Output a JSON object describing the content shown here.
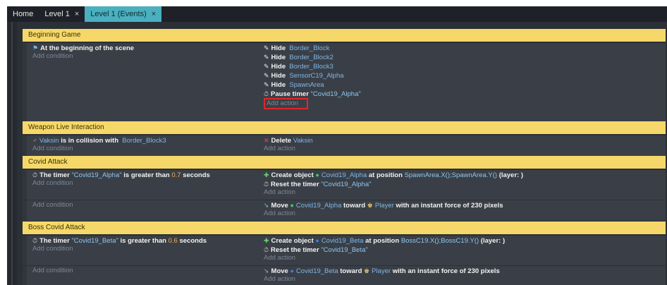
{
  "tabs": [
    {
      "label": "Home",
      "close": ""
    },
    {
      "label": "Level 1",
      "close": "×"
    },
    {
      "label": "Level 1 (Events)",
      "close": "×"
    }
  ],
  "groups": [
    {
      "comment": "Beginning Game",
      "events": [
        {
          "conditions": [
            {
              "text": "At the beginning of the scene"
            }
          ],
          "add_condition": "Add condition",
          "actions": [
            {
              "verb": "Hide",
              "object": "Border_Block"
            },
            {
              "verb": "Hide",
              "object": "Border_Block2"
            },
            {
              "verb": "Hide",
              "object": "Border_Block3"
            },
            {
              "verb": "Hide",
              "object": "SensorC19_Alpha"
            },
            {
              "verb": "Hide",
              "object": "SpawnArea"
            },
            {
              "verb": "Pause timer",
              "value": "\"Covid19_Alpha\""
            }
          ],
          "add_action": "Add action"
        }
      ]
    },
    {
      "comment": "Weapon Live Interaction",
      "events": [
        {
          "conditions": [
            {
              "pre": "Vaksin",
              "mid": "is in collision with",
              "post": "Border_Block3"
            }
          ],
          "add_condition": "Add condition",
          "actions": [
            {
              "verb": "Delete",
              "object": "Vaksin"
            }
          ],
          "add_action": "Add action"
        }
      ]
    },
    {
      "comment": "Covid Attack",
      "events": [
        {
          "conditions": [
            {
              "pre": "The timer",
              "mid": "\"Covid19_Alpha\"",
              "post": "is greater than",
              "num": "0.7",
              "tail": "seconds"
            }
          ],
          "add_condition": "Add condition",
          "actions": [
            {
              "verb": "Create object",
              "object": "Covid19_Alpha",
              "extra": "at position",
              "value": "SpawnArea.X();SpawnArea.Y()",
              "tail": "(layer: )"
            },
            {
              "verb": "Reset the timer",
              "value": "\"Covid19_Alpha\""
            }
          ],
          "add_action": "Add action"
        },
        {
          "conditions": [],
          "add_condition": "Add condition",
          "actions": [
            {
              "verb": "Move",
              "object": "Covid19_Alpha",
              "extra": "toward",
              "value": "Player",
              "tail": "with an instant force of 230 pixels"
            }
          ],
          "add_action": "Add action"
        }
      ]
    },
    {
      "comment": "Boss Covid Attack",
      "events": [
        {
          "conditions": [
            {
              "pre": "The timer",
              "mid": "\"Covid19_Beta\"",
              "post": "is greater than",
              "num": "0.6",
              "tail": "seconds"
            }
          ],
          "add_condition": "Add condition",
          "actions": [
            {
              "verb": "Create object",
              "object": "Covid19_Beta",
              "extra": "at position",
              "value": "BossC19.X();BossC19.Y()",
              "tail": "(layer: )"
            },
            {
              "verb": "Reset the timer",
              "value": "\"Covid19_Beta\""
            }
          ],
          "add_action": "Add action"
        },
        {
          "conditions": [],
          "add_condition": "Add condition",
          "actions": [
            {
              "verb": "Move",
              "object": "Covid19_Beta",
              "extra": "toward",
              "value": "Player",
              "tail": "with an instant force of 230 pixels"
            }
          ],
          "add_action": "Add action"
        }
      ]
    }
  ],
  "colors": {
    "comment_bg": "#f6d86a",
    "tab_active": "#4ab0c0",
    "highlight_box": "#e0262a"
  }
}
